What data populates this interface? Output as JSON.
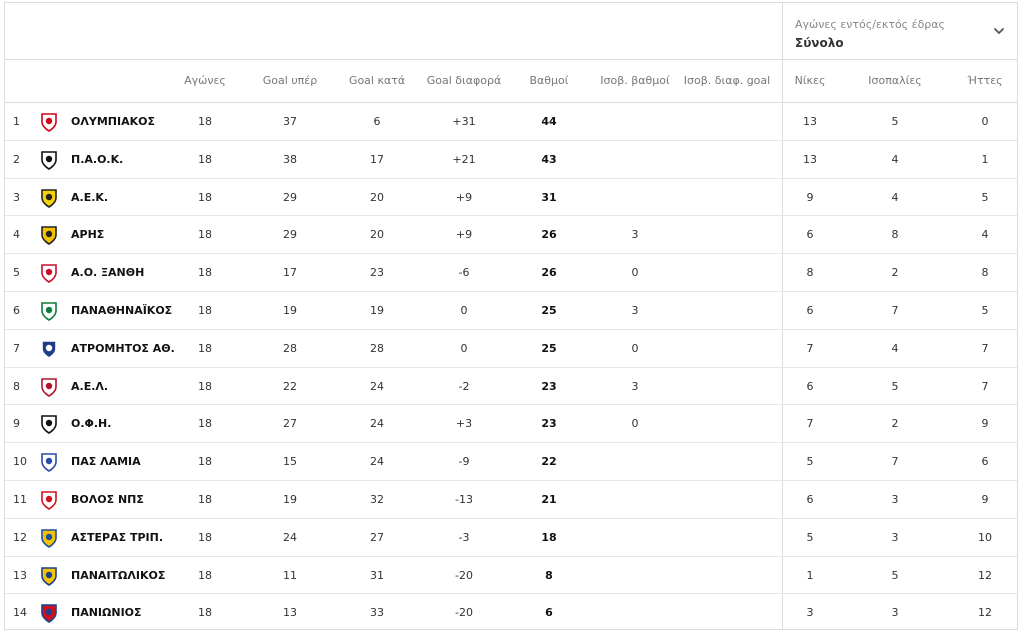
{
  "filter": {
    "label": "Αγώνες εντός/εκτός έδρας",
    "value": "Σύνολο"
  },
  "columns": {
    "played": "Αγώνες",
    "goals_for": "Goal υπέρ",
    "goals_against": "Goal κατά",
    "goal_diff": "Goal διαφορά",
    "points": "Βαθμοί",
    "tie_points": "Ισοβ. βαθμοί",
    "tie_goal_diff": "Ισοβ. διαφ. goal",
    "wins": "Νίκες",
    "draws": "Ισοπαλίες",
    "losses": "Ήττες"
  },
  "rows": [
    {
      "pos": "1",
      "team": "ΟΛΥΜΠΙΑΚΟΣ",
      "played": "18",
      "gf": "37",
      "ga": "6",
      "gd": "+31",
      "pts": "44",
      "tie_pts": "",
      "tie_gd": "",
      "w": "13",
      "d": "5",
      "l": "0",
      "colors": [
        "#ffffff",
        "#d0021b"
      ]
    },
    {
      "pos": "2",
      "team": "Π.Α.Ο.Κ.",
      "played": "18",
      "gf": "38",
      "ga": "17",
      "gd": "+21",
      "pts": "43",
      "tie_pts": "",
      "tie_gd": "",
      "w": "13",
      "d": "4",
      "l": "1",
      "colors": [
        "#ffffff",
        "#111111"
      ]
    },
    {
      "pos": "3",
      "team": "Α.Ε.Κ.",
      "played": "18",
      "gf": "29",
      "ga": "20",
      "gd": "+9",
      "pts": "31",
      "tie_pts": "",
      "tie_gd": "",
      "w": "9",
      "d": "4",
      "l": "5",
      "colors": [
        "#f5d20a",
        "#222222"
      ]
    },
    {
      "pos": "4",
      "team": "ΑΡΗΣ",
      "played": "18",
      "gf": "29",
      "ga": "20",
      "gd": "+9",
      "pts": "26",
      "tie_pts": "3",
      "tie_gd": "",
      "w": "6",
      "d": "8",
      "l": "4",
      "colors": [
        "#f5c400",
        "#222222"
      ]
    },
    {
      "pos": "5",
      "team": "Α.Ο. ΞΑΝΘΗ",
      "played": "18",
      "gf": "17",
      "ga": "23",
      "gd": "-6",
      "pts": "26",
      "tie_pts": "0",
      "tie_gd": "",
      "w": "8",
      "d": "2",
      "l": "8",
      "colors": [
        "#ffffff",
        "#c8102e"
      ]
    },
    {
      "pos": "6",
      "team": "ΠΑΝΑΘΗΝΑΪΚΟΣ",
      "played": "18",
      "gf": "19",
      "ga": "19",
      "gd": "0",
      "pts": "25",
      "tie_pts": "3",
      "tie_gd": "",
      "w": "6",
      "d": "7",
      "l": "5",
      "colors": [
        "#ffffff",
        "#0a7d3b"
      ]
    },
    {
      "pos": "7",
      "team": "ΑΤΡΟΜΗΤΟΣ ΑΘ.",
      "played": "18",
      "gf": "28",
      "ga": "28",
      "gd": "0",
      "pts": "25",
      "tie_pts": "0",
      "tie_gd": "",
      "w": "7",
      "d": "4",
      "l": "7",
      "colors": [
        "#1f3c88",
        "#ffffff"
      ]
    },
    {
      "pos": "8",
      "team": "Α.Ε.Λ.",
      "played": "18",
      "gf": "22",
      "ga": "24",
      "gd": "-2",
      "pts": "23",
      "tie_pts": "3",
      "tie_gd": "",
      "w": "6",
      "d": "5",
      "l": "7",
      "colors": [
        "#ffffff",
        "#b3122b"
      ]
    },
    {
      "pos": "9",
      "team": "Ο.Φ.Η.",
      "played": "18",
      "gf": "27",
      "ga": "24",
      "gd": "+3",
      "pts": "23",
      "tie_pts": "0",
      "tie_gd": "",
      "w": "7",
      "d": "2",
      "l": "9",
      "colors": [
        "#ffffff",
        "#111111"
      ]
    },
    {
      "pos": "10",
      "team": "ΠΑΣ ΛΑΜΙΑ",
      "played": "18",
      "gf": "15",
      "ga": "24",
      "gd": "-9",
      "pts": "22",
      "tie_pts": "",
      "tie_gd": "",
      "w": "5",
      "d": "7",
      "l": "6",
      "colors": [
        "#ffffff",
        "#2a4aa8"
      ]
    },
    {
      "pos": "11",
      "team": "ΒΟΛΟΣ ΝΠΣ",
      "played": "18",
      "gf": "19",
      "ga": "32",
      "gd": "-13",
      "pts": "21",
      "tie_pts": "",
      "tie_gd": "",
      "w": "6",
      "d": "3",
      "l": "9",
      "colors": [
        "#ffffff",
        "#d0101c"
      ]
    },
    {
      "pos": "12",
      "team": "ΑΣΤΕΡΑΣ ΤΡΙΠ.",
      "played": "18",
      "gf": "24",
      "ga": "27",
      "gd": "-3",
      "pts": "18",
      "tie_pts": "",
      "tie_gd": "",
      "w": "5",
      "d": "3",
      "l": "10",
      "colors": [
        "#f5c400",
        "#1d4fa0"
      ]
    },
    {
      "pos": "13",
      "team": "ΠΑΝΑΙΤΩΛΙΚΟΣ",
      "played": "18",
      "gf": "11",
      "ga": "31",
      "gd": "-20",
      "pts": "8",
      "tie_pts": "",
      "tie_gd": "",
      "w": "1",
      "d": "5",
      "l": "12",
      "colors": [
        "#f5c400",
        "#1d3f8f"
      ]
    },
    {
      "pos": "14",
      "team": "ΠΑΝΙΩΝΙΟΣ",
      "played": "18",
      "gf": "13",
      "ga": "33",
      "gd": "-20",
      "pts": "6",
      "tie_pts": "",
      "tie_gd": "",
      "w": "3",
      "d": "3",
      "l": "12",
      "colors": [
        "#d0101c",
        "#1d3f8f"
      ]
    }
  ]
}
